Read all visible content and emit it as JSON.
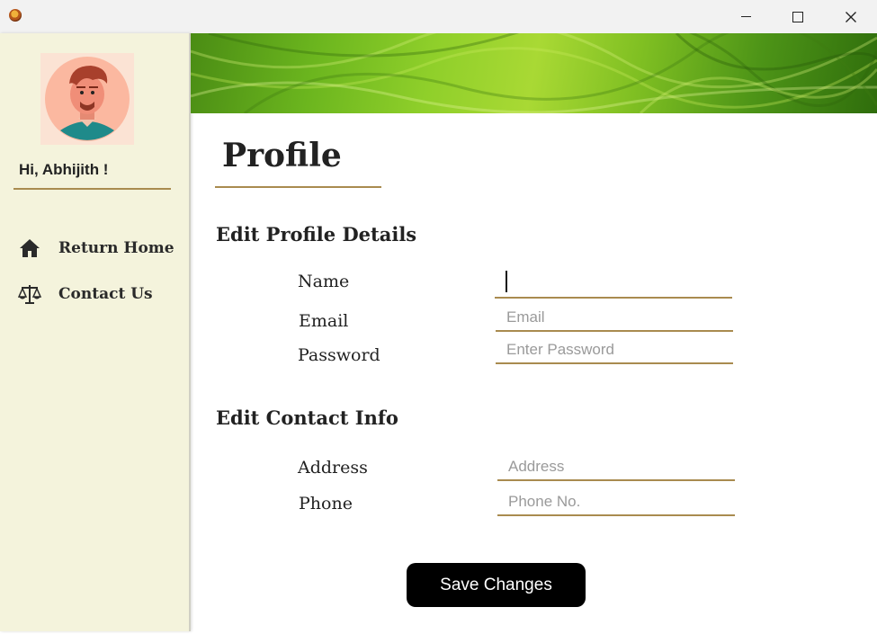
{
  "window": {
    "icons": {
      "app": "app-icon",
      "minimize": "minimize-icon",
      "maximize": "maximize-icon",
      "close": "close-icon"
    }
  },
  "sidebar": {
    "greeting": "Hi, Abhijith !",
    "items": [
      {
        "label": "Return Home",
        "icon": "home-icon"
      },
      {
        "label": "Contact Us",
        "icon": "scales-icon"
      }
    ]
  },
  "main": {
    "title": "Profile",
    "profile_section": {
      "title": "Edit Profile Details",
      "name_label": "Name",
      "name_value": "",
      "email_label": "Email",
      "email_placeholder": "Email",
      "password_label": "Password",
      "password_placeholder": "Enter Password"
    },
    "contact_section": {
      "title": "Edit Contact Info",
      "address_label": "Address",
      "address_placeholder": "Address",
      "phone_label": "Phone",
      "phone_placeholder": "Phone No."
    },
    "save_label": "Save Changes"
  },
  "colors": {
    "sidebar_bg": "#f4f3dc",
    "accent_line": "#a98b4f",
    "button_bg": "#000000",
    "button_text": "#ffffff"
  }
}
